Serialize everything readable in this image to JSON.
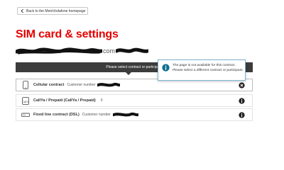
{
  "back_link": {
    "label": "Back to the MeinVodafone homepage",
    "icon": "chevron-left-icon"
  },
  "page_title": "SIM card & settings",
  "account": {
    "visible_fragment": "com"
  },
  "select_bar": {
    "text": "Please select contract or participant"
  },
  "tooltip": {
    "icon": "info-icon",
    "line1": "The page is not available for this contract.",
    "line2": "Please select a different contract or participant."
  },
  "contracts": [
    {
      "name": "Cellular contract",
      "meta_label": "Customer number",
      "meta_value": "",
      "device_icon": "phone-icon",
      "status_icon": "close-icon"
    },
    {
      "name": "CallYa / Prepaid (CallYa / Prepaid)",
      "meta_label": "",
      "meta_value": "0",
      "device_icon": "prepaid-sim-icon",
      "status_icon": "info-icon"
    },
    {
      "name": "Fixed line contract (DSL)",
      "meta_label": "Customer number",
      "meta_value": "",
      "device_icon": "router-icon",
      "status_icon": "info-icon"
    }
  ],
  "colors": {
    "brand_red": "#e60000",
    "dark_bar": "#3c3c3c",
    "info_blue": "#0e6e8e"
  }
}
